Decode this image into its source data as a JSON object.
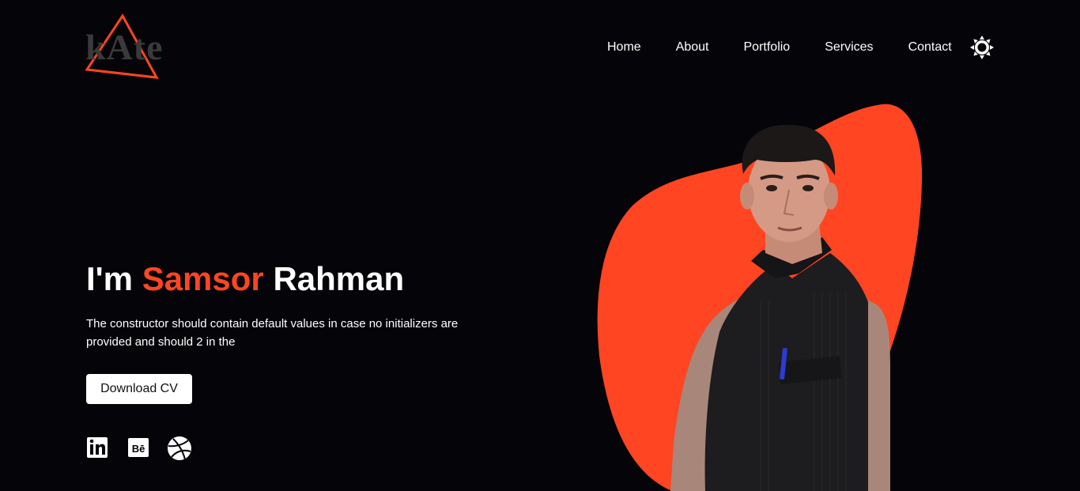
{
  "logo": {
    "text": "kAte"
  },
  "nav": {
    "items": [
      "Home",
      "About",
      "Portfolio",
      "Services",
      "Contact"
    ]
  },
  "hero": {
    "greeting": "I'm",
    "first_name": "Samsor",
    "last_name": "Rahman",
    "description": "The constructor should contain default values in case no initializers are provided and should 2 in the",
    "cta_label": "Download CV"
  },
  "social": {
    "items": [
      {
        "name": "linkedin-icon",
        "glyph": "in"
      },
      {
        "name": "behance-icon",
        "glyph": "Bē"
      },
      {
        "name": "dribbble-icon",
        "glyph": ""
      }
    ]
  },
  "colors": {
    "background": "#050509",
    "accent": "#ff4521",
    "text": "#ffffff",
    "logo_text": "#3a3a3a"
  }
}
